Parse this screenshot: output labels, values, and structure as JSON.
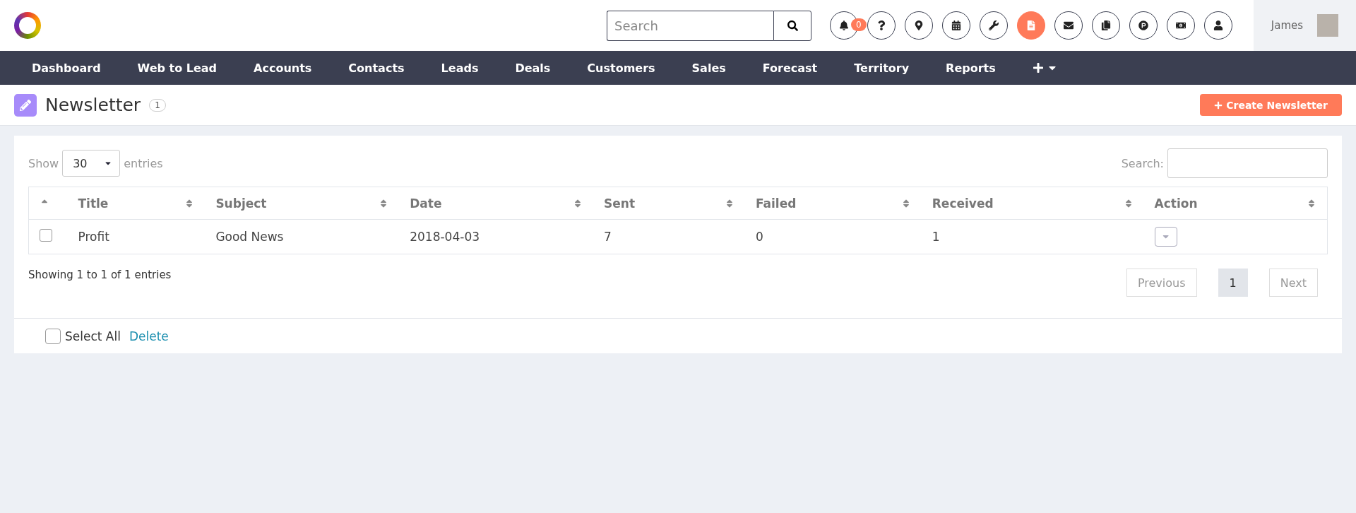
{
  "header": {
    "search": {
      "placeholder": "Search"
    },
    "icons": [
      {
        "kind": "bell",
        "badge": "0",
        "selected": false
      },
      {
        "kind": "question",
        "selected": false
      },
      {
        "kind": "pin",
        "selected": false
      },
      {
        "kind": "calendar",
        "selected": false
      },
      {
        "kind": "wrench",
        "selected": false
      },
      {
        "kind": "document",
        "selected": true
      },
      {
        "kind": "envelope",
        "selected": false
      },
      {
        "kind": "copy",
        "selected": false
      },
      {
        "kind": "p-circle",
        "selected": false
      },
      {
        "kind": "money",
        "selected": false
      },
      {
        "kind": "user",
        "selected": false
      }
    ],
    "user": {
      "name": "James"
    }
  },
  "nav": {
    "items": [
      "Dashboard",
      "Web to Lead",
      "Accounts",
      "Contacts",
      "Leads",
      "Deals",
      "Customers",
      "Sales",
      "Forecast",
      "Territory",
      "Reports"
    ]
  },
  "page": {
    "title": "Newsletter",
    "count": "1",
    "create_button": "Create Newsletter"
  },
  "table_controls": {
    "show_label": "Show",
    "page_size": "30",
    "entries_label": "entries",
    "search_label": "Search:"
  },
  "table": {
    "columns": [
      {
        "sorted": true
      },
      {
        "label": "Title",
        "sorted": false
      },
      {
        "label": "Subject",
        "sorted": false
      },
      {
        "label": "Date",
        "sorted": false
      },
      {
        "label": "Sent",
        "sorted": false
      },
      {
        "label": "Failed",
        "sorted": false
      },
      {
        "label": "Received",
        "sorted": false
      },
      {
        "label": "Action",
        "sorted": false
      }
    ],
    "rows": [
      {
        "cells": [
          {
            "kind": "checkbox",
            "checked": false
          },
          {
            "kind": "text",
            "text": "Profit"
          },
          {
            "kind": "text",
            "text": "Good News"
          },
          {
            "kind": "text",
            "text": "2018-04-03"
          },
          {
            "kind": "text",
            "text": "7"
          },
          {
            "kind": "text",
            "text": "0"
          },
          {
            "kind": "text",
            "text": "1"
          },
          {
            "kind": "action"
          }
        ]
      }
    ]
  },
  "info": "Showing 1 to 1 of 1 entries",
  "pagination": [
    {
      "label": "Previous",
      "selected": false
    },
    {
      "label": "1",
      "selected": true
    },
    {
      "label": "Next",
      "selected": false
    }
  ],
  "footer": {
    "select_all": {
      "label": "Select All",
      "checked": false
    },
    "delete": "Delete"
  }
}
